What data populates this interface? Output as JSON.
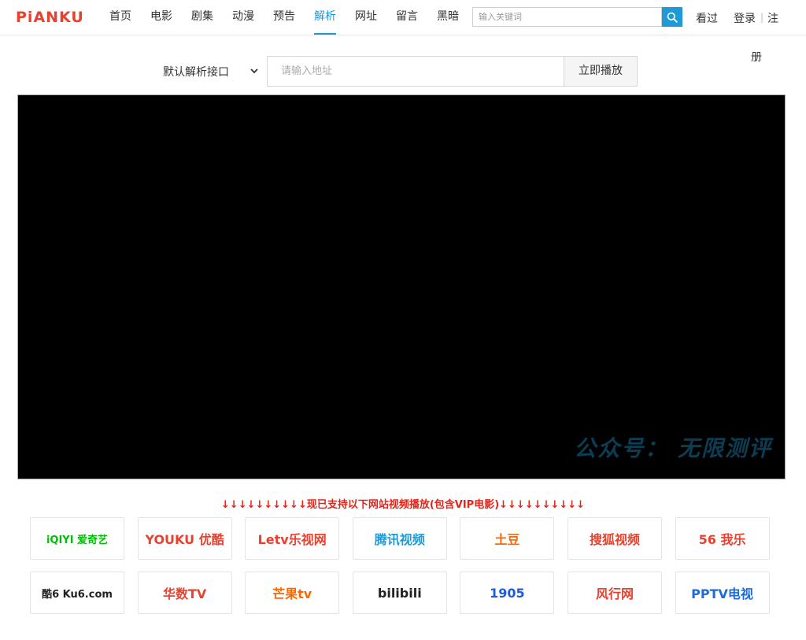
{
  "header": {
    "logo": "PiANKU",
    "nav": [
      "首页",
      "电影",
      "剧集",
      "动漫",
      "预告",
      "解析",
      "网址",
      "留言",
      "黑暗"
    ],
    "active_nav": "解析",
    "search_placeholder": "输入关键词",
    "watched": "看过",
    "login": "登录",
    "separator": "|",
    "register_1": "注",
    "register_2": "册"
  },
  "parser": {
    "interface_label": "默认解析接口",
    "url_placeholder": "请输入地址",
    "play_button": "立即播放"
  },
  "player": {
    "watermark": "公众号：  无限测评"
  },
  "notice": "↓↓↓↓↓↓↓↓↓↓现已支持以下网站视频播放(包含VIP电影)↓↓↓↓↓↓↓↓↓↓",
  "sites": [
    {
      "name": "iqiyi",
      "text": "iQIYI 爱奇艺",
      "color": "#00be06"
    },
    {
      "name": "youku",
      "text": "YOUKU 优酷",
      "color": "#e8412e"
    },
    {
      "name": "letv",
      "text": "Letv乐视网",
      "color": "#e8412e"
    },
    {
      "name": "tencent",
      "text": "腾讯视频",
      "color": "#1e9bd7"
    },
    {
      "name": "tudou",
      "text": "土豆",
      "color": "#ff6600"
    },
    {
      "name": "sohu",
      "text": "搜狐视频",
      "color": "#e8412e"
    },
    {
      "name": "56",
      "text": "56 我乐",
      "color": "#e8412e"
    },
    {
      "name": "ku6",
      "text": "酷6 Ku6.com",
      "color": "#222222"
    },
    {
      "name": "huashu",
      "text": "华数TV",
      "color": "#e8412e"
    },
    {
      "name": "mgtv",
      "text": "芒果tv",
      "color": "#ff6600"
    },
    {
      "name": "bilibili",
      "text": "bilibili",
      "color": "#222222"
    },
    {
      "name": "1905",
      "text": "1905",
      "color": "#1e5bd7"
    },
    {
      "name": "fengxing",
      "text": "风行网",
      "color": "#e8412e"
    },
    {
      "name": "pptv",
      "text": "PPTV电视",
      "color": "#1e6bd7"
    }
  ]
}
